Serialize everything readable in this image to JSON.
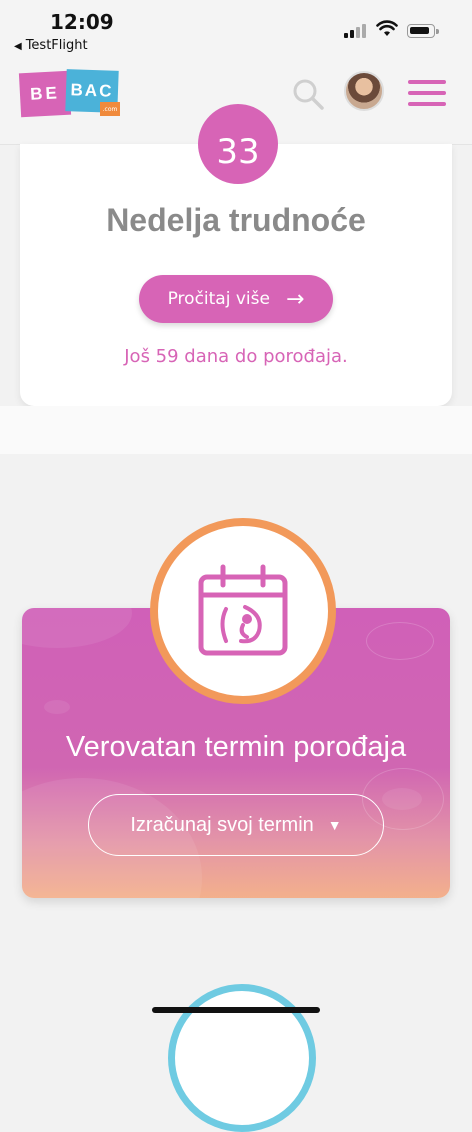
{
  "status_bar": {
    "time": "12:09",
    "back_app": "TestFlight"
  },
  "header": {
    "logo": {
      "part1": "BE",
      "part2": "BAC",
      "suffix": ".com"
    },
    "colors": {
      "brand_pink": "#d764b6",
      "brand_blue": "#4bb2d9",
      "brand_orange": "#f08a3c"
    }
  },
  "week_card": {
    "week_number": "33",
    "week_label": "Nedelja trudnoće",
    "read_more_label": "Pročitaj više",
    "countdown_text": "Još 59 dana do porođaja."
  },
  "due_date_card": {
    "title": "Verovatan termin porođaja",
    "button_label": "Izračunaj svoj termin",
    "icon": "calendar-baby-icon",
    "colors": {
      "ring": "#f2995a",
      "gradient_top": "#d060b8",
      "gradient_bottom": "#f3b08c"
    }
  }
}
